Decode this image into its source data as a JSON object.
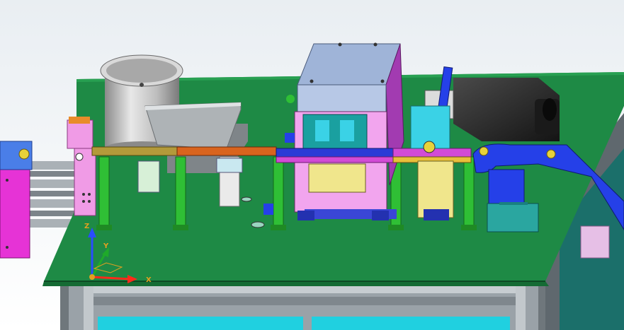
{
  "viewport": {
    "background_top": "#e9eef2",
    "background_bottom": "#ffffff"
  },
  "triad": {
    "z_label": "Z",
    "y_label": "Y",
    "x_label": "X",
    "z_color": "#2a4cff",
    "y_color": "#1faa2a",
    "x_color": "#ff2a1a"
  },
  "colors": {
    "table_top": "#1e8a45",
    "table_edge": "#156b34",
    "frame": "#8e969c",
    "leg_green": "#2fbf35",
    "rail_gold": "#b39a3a",
    "rail_orange": "#d9641e",
    "rail_blue": "#2a3bd6",
    "rail_magenta": "#d24bd6",
    "bowl": "#c9c9c9",
    "housing_top": "#9fb4d8",
    "housing_side": "#a23bb1",
    "motor": "#2b2b2b",
    "arm_blue": "#2540e8",
    "cyan_panel": "#20d0e0"
  },
  "icons": {
    "triad": "coordinate-triad-icon"
  }
}
